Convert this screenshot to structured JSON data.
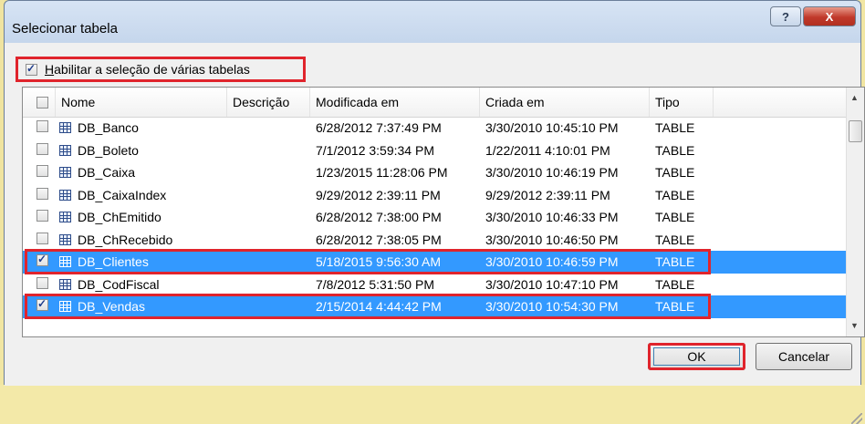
{
  "window": {
    "title": "Selecionar tabela",
    "help_glyph": "?",
    "close_glyph": "X"
  },
  "multi_select": {
    "label_underlined": "H",
    "label_rest": "abilitar a seleção de várias tabelas",
    "checked": true
  },
  "columns": [
    "Nome",
    "Descrição",
    "Modificada em",
    "Criada em",
    "Tipo"
  ],
  "rows": [
    {
      "name": "DB_Banco",
      "description": "",
      "modified": "6/28/2012 7:37:49 PM",
      "created": "3/30/2010 10:45:10 PM",
      "type": "TABLE",
      "checked": false,
      "selected": false
    },
    {
      "name": "DB_Boleto",
      "description": "",
      "modified": "7/1/2012 3:59:34 PM",
      "created": "1/22/2011 4:10:01 PM",
      "type": "TABLE",
      "checked": false,
      "selected": false
    },
    {
      "name": "DB_Caixa",
      "description": "",
      "modified": "1/23/2015 11:28:06 PM",
      "created": "3/30/2010 10:46:19 PM",
      "type": "TABLE",
      "checked": false,
      "selected": false
    },
    {
      "name": "DB_CaixaIndex",
      "description": "",
      "modified": "9/29/2012 2:39:11 PM",
      "created": "9/29/2012 2:39:11 PM",
      "type": "TABLE",
      "checked": false,
      "selected": false
    },
    {
      "name": "DB_ChEmitido",
      "description": "",
      "modified": "6/28/2012 7:38:00 PM",
      "created": "3/30/2010 10:46:33 PM",
      "type": "TABLE",
      "checked": false,
      "selected": false
    },
    {
      "name": "DB_ChRecebido",
      "description": "",
      "modified": "6/28/2012 7:38:05 PM",
      "created": "3/30/2010 10:46:50 PM",
      "type": "TABLE",
      "checked": false,
      "selected": false
    },
    {
      "name": "DB_Clientes",
      "description": "",
      "modified": "5/18/2015 9:56:30 AM",
      "created": "3/30/2010 10:46:59 PM",
      "type": "TABLE",
      "checked": true,
      "selected": true
    },
    {
      "name": "DB_CodFiscal",
      "description": "",
      "modified": "7/8/2012 5:31:50 PM",
      "created": "3/30/2010 10:47:10 PM",
      "type": "TABLE",
      "checked": false,
      "selected": false
    },
    {
      "name": "DB_Vendas",
      "description": "",
      "modified": "2/15/2014 4:44:42 PM",
      "created": "3/30/2010 10:54:30 PM",
      "type": "TABLE",
      "checked": true,
      "selected": true
    }
  ],
  "buttons": {
    "ok": "OK",
    "cancel": "Cancelar"
  },
  "colors": {
    "selection": "#3399ff",
    "highlight_box": "#e0242c"
  }
}
